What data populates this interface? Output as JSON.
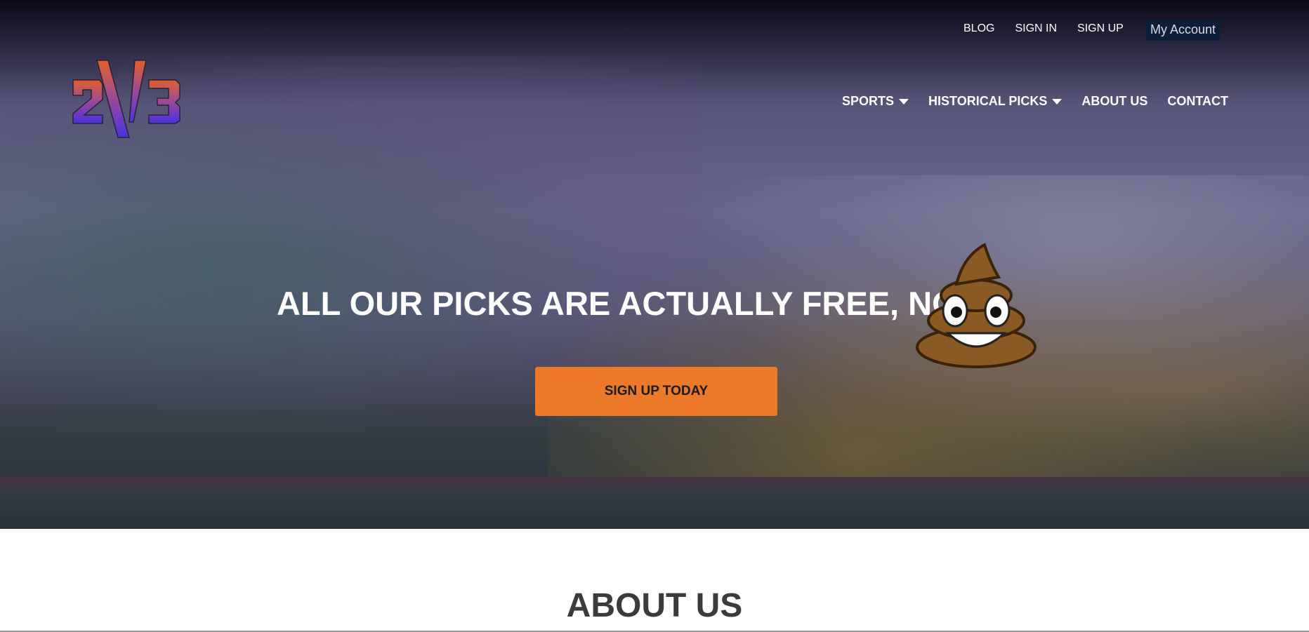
{
  "top_links": {
    "blog": "BLOG",
    "sign_in": "SIGN IN",
    "sign_up": "SIGN UP",
    "my_account": "My Account"
  },
  "logo": {
    "text": "2V3"
  },
  "nav": {
    "sports": "SPORTS",
    "historical_picks": "HISTORICAL PICKS",
    "about_us": "ABOUT US",
    "contact": "CONTACT"
  },
  "hero": {
    "headline": "ALL OUR PICKS ARE ACTUALLY FREE, NO",
    "cta": "SIGN UP TODAY",
    "cta_color": "#ec7a28"
  },
  "about": {
    "heading": "ABOUT US"
  }
}
